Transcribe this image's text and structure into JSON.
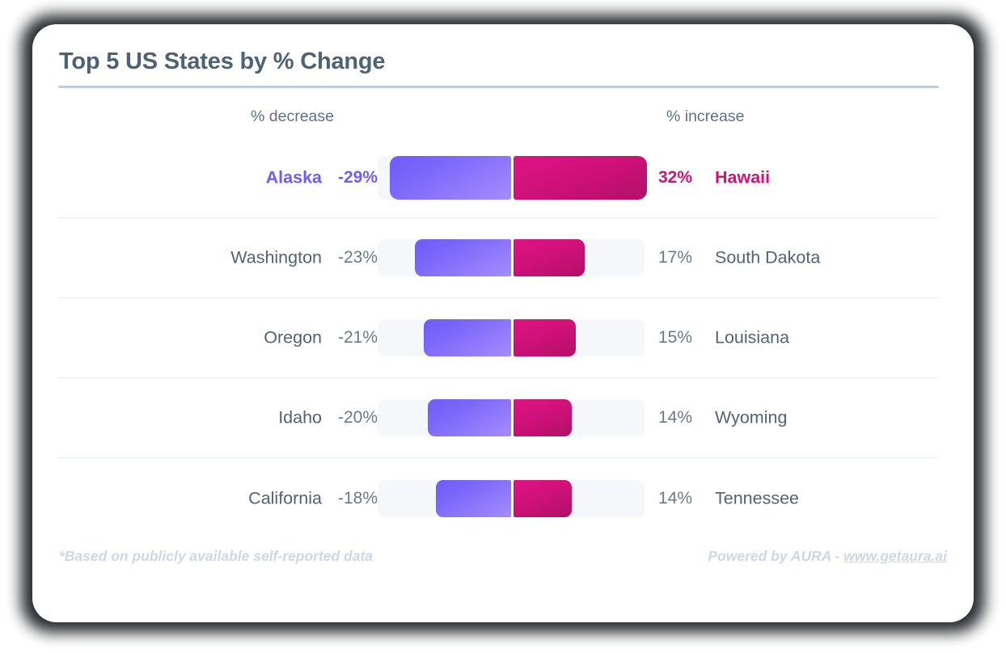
{
  "chart_data": {
    "type": "bar",
    "title": "Top 5 US States by % Change",
    "subtype": "diverging-bidirectional-bar",
    "xlabel": "",
    "ylabel": "",
    "axis_max_abs": 32,
    "grid": false,
    "legend_position": "top",
    "left_axis_label": "% decrease",
    "right_axis_label": "% increase",
    "categories": [
      "1",
      "2",
      "3",
      "4",
      "5"
    ],
    "series": [
      {
        "name": "% decrease",
        "labels": [
          "Alaska",
          "Washington",
          "Oregon",
          "Idaho",
          "California"
        ],
        "values": [
          -29,
          -23,
          -21,
          -20,
          -18
        ],
        "value_labels": [
          "-29%",
          "-23%",
          "-21%",
          "-20%",
          "-18%"
        ],
        "color": "#7d68fa"
      },
      {
        "name": "% increase",
        "labels": [
          "Hawaii",
          "South Dakota",
          "Louisiana",
          "Wyoming",
          "Tennessee"
        ],
        "values": [
          32,
          17,
          15,
          14,
          14
        ],
        "value_labels": [
          "32%",
          "17%",
          "15%",
          "14%",
          "14%"
        ],
        "color": "#d0117a"
      }
    ]
  },
  "header": {
    "title": "Top 5 US States by % Change",
    "left_column_label": "% decrease",
    "right_column_label": "% increase"
  },
  "rows": [
    {
      "left_state": "Alaska",
      "left_pct": "-29%",
      "left_value": 29,
      "right_pct": "32%",
      "right_state": "Hawaii",
      "right_value": 32,
      "featured": true
    },
    {
      "left_state": "Washington",
      "left_pct": "-23%",
      "left_value": 23,
      "right_pct": "17%",
      "right_state": "South Dakota",
      "right_value": 17,
      "featured": false
    },
    {
      "left_state": "Oregon",
      "left_pct": "-21%",
      "left_value": 21,
      "right_pct": "15%",
      "right_state": "Louisiana",
      "right_value": 15,
      "featured": false
    },
    {
      "left_state": "Idaho",
      "left_pct": "-20%",
      "left_value": 20,
      "right_pct": "14%",
      "right_state": "Wyoming",
      "right_value": 14,
      "featured": false
    },
    {
      "left_state": "California",
      "left_pct": "-18%",
      "left_value": 18,
      "right_pct": "14%",
      "right_state": "Tennessee",
      "right_value": 14,
      "featured": false
    }
  ],
  "footer": {
    "footnote": "*Based on publicly available self-reported data",
    "powered_prefix": "Powered by AURA - ",
    "powered_link": "www.getaura.ai"
  },
  "colors": {
    "decrease_accent": "#6f5cf4",
    "increase_accent": "#cf1378",
    "title_text": "#4e6273",
    "body_text": "#50637a",
    "muted_text": "#69798c",
    "track": "#f6f7fb",
    "divider": "#e7edf2",
    "rule": "#bfcdd8",
    "footer_text": "#ccd8e3"
  }
}
